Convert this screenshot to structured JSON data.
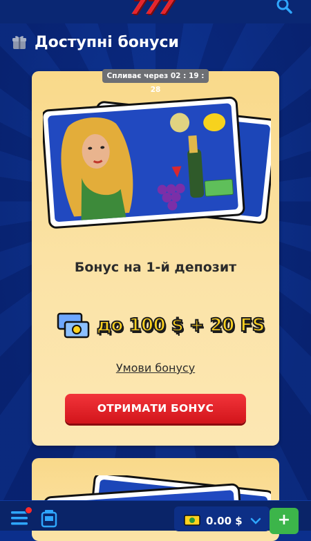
{
  "header": {
    "logo_text": "777",
    "brand_color": "#e8232b",
    "search_icon": "search-icon"
  },
  "page": {
    "title": "Доступні бонуси",
    "title_icon": "gift-icon"
  },
  "bonus_card": {
    "expires_label": "Спливає через 02 : 19 : 28",
    "title": "Бонус на 1-й депозит",
    "amount": "до 100 $ + 20 FS",
    "terms_link": "Умови бонусу",
    "cta_label": "ОТРИМАТИ БОНУС",
    "cta_color": "#e3242b",
    "card_color": "#fbe3a7"
  },
  "bottom_bar": {
    "balance": "0.00 $",
    "deposit_label": "+",
    "deposit_color": "#3cb54a",
    "icons": [
      "menu-icon",
      "slot-machine-icon",
      "wallet-icon",
      "chevron-down-icon"
    ]
  }
}
